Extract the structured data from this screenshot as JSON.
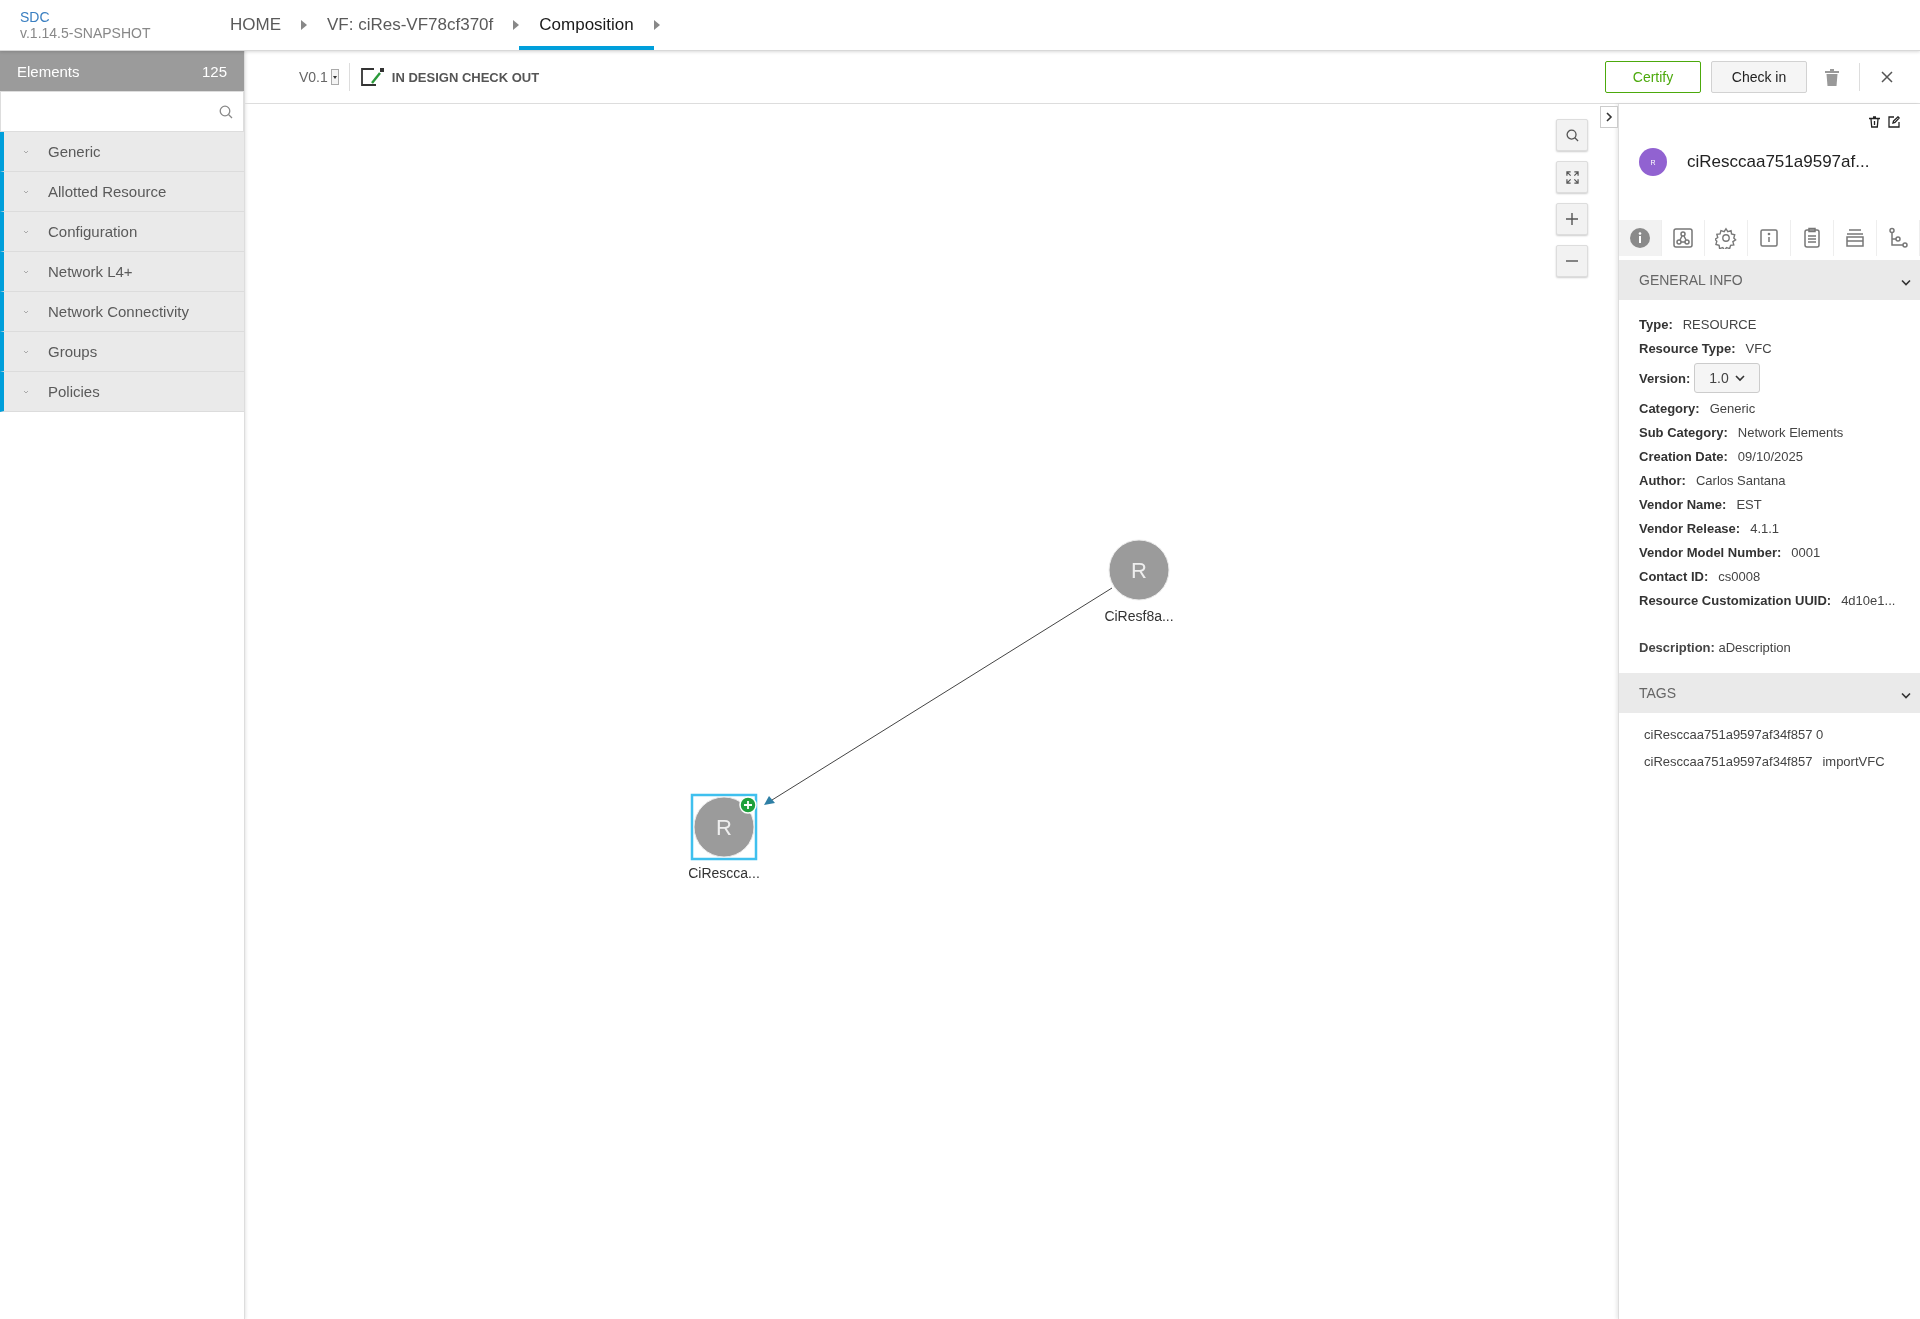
{
  "header": {
    "app_name": "SDC",
    "version": "v.1.14.5-SNAPSHOT",
    "breadcrumbs": [
      {
        "label": "HOME",
        "selected": false
      },
      {
        "label": "VF: ciRes-VF78cf370f",
        "selected": false
      },
      {
        "label": "Composition",
        "selected": true
      }
    ]
  },
  "sidebar": {
    "title": "Elements",
    "count": "125",
    "categories": [
      {
        "label": "Generic"
      },
      {
        "label": "Allotted Resource"
      },
      {
        "label": "Configuration"
      },
      {
        "label": "Network L4+"
      },
      {
        "label": "Network Connectivity"
      },
      {
        "label": "Groups"
      },
      {
        "label": "Policies"
      }
    ]
  },
  "toolbar": {
    "version": "V0.1",
    "status": "IN DESIGN CHECK OUT",
    "buttons": [
      {
        "label": "Certify",
        "kind": "primary"
      },
      {
        "label": "Check in",
        "kind": "secondary"
      }
    ]
  },
  "canvas": {
    "nodes": [
      {
        "letter": "R",
        "label": "CiResf8a...",
        "selected": false,
        "added": false
      },
      {
        "letter": "R",
        "label": "CiRescca...",
        "selected": true,
        "added": true
      }
    ]
  },
  "panel": {
    "avatar_letter": "R",
    "title": "ciResccaa751a9597af...",
    "tabs": [
      {
        "selected": true
      },
      {
        "selected": false
      },
      {
        "selected": false
      },
      {
        "selected": false
      },
      {
        "selected": false
      },
      {
        "selected": false
      },
      {
        "selected": false
      }
    ],
    "general_info": {
      "title": "GENERAL INFO",
      "expanded": true,
      "fields": [
        {
          "label": "Type:",
          "value": "RESOURCE",
          "kind": "text"
        },
        {
          "label": "Resource Type:",
          "value": "VFC",
          "kind": "text"
        },
        {
          "label": "Version:",
          "value": "1.0",
          "kind": "dropdown"
        },
        {
          "label": "Category:",
          "value": "Generic",
          "kind": "text"
        },
        {
          "label": "Sub Category:",
          "value": "Network Elements",
          "kind": "text"
        },
        {
          "label": "Creation Date:",
          "value": "09/10/2025",
          "kind": "text"
        },
        {
          "label": "Author:",
          "value": "Carlos Santana",
          "kind": "text"
        },
        {
          "label": "Vendor Name:",
          "value": "EST",
          "kind": "text"
        },
        {
          "label": "Vendor Release:",
          "value": "4.1.1",
          "kind": "text"
        },
        {
          "label": "Vendor Model Number:",
          "value": "0001",
          "kind": "text"
        },
        {
          "label": "Contact ID:",
          "value": "cs0008",
          "kind": "text"
        },
        {
          "label": "Resource Customization UUID:",
          "value": "4d10e1...",
          "kind": "text"
        }
      ],
      "description": {
        "label": "Description:",
        "value": "aDescription"
      }
    },
    "tags": {
      "title": "TAGS",
      "expanded": true,
      "items": [
        {
          "name": "ciResccaa751a9597af34f857 0"
        },
        {
          "name": "ciResccaa751a9597af34f857",
          "extra": "importVFC"
        }
      ]
    }
  }
}
